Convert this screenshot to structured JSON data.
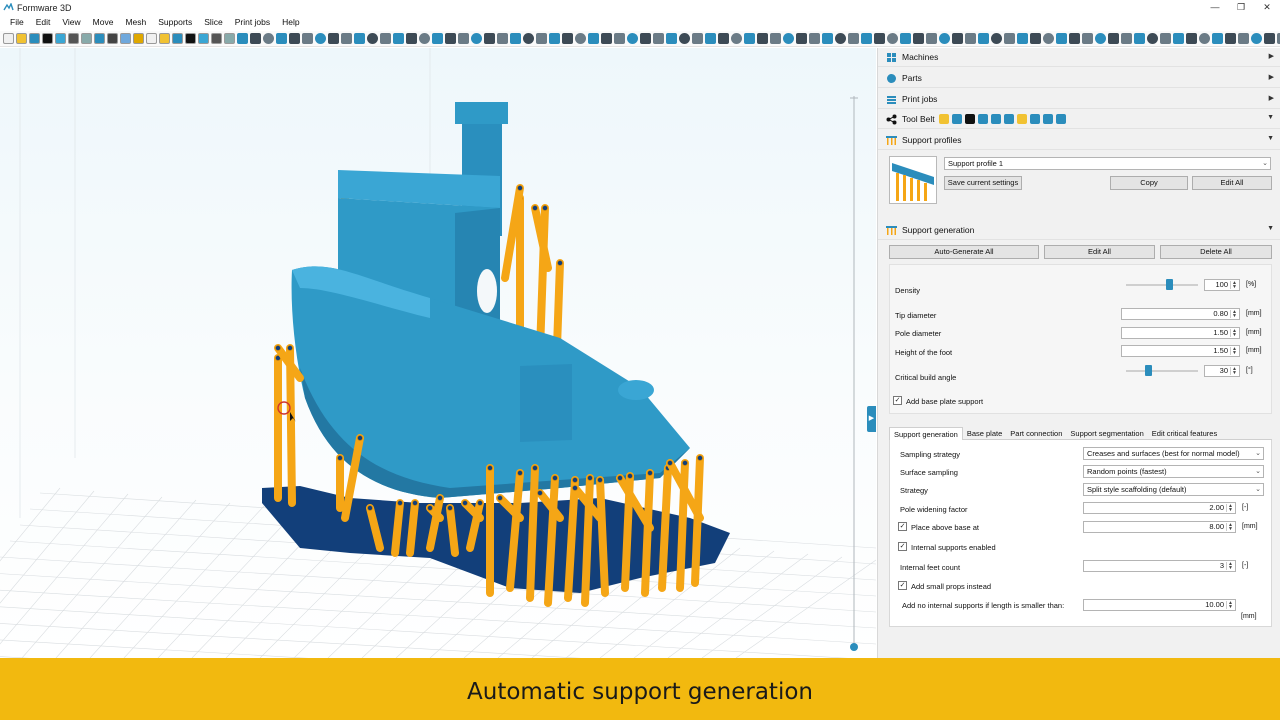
{
  "window": {
    "title": "Formware 3D",
    "controls": [
      "—",
      "❐",
      "✕"
    ]
  },
  "menu": [
    "File",
    "Edit",
    "View",
    "Move",
    "Mesh",
    "Supports",
    "Slice",
    "Print jobs",
    "Help"
  ],
  "panel": {
    "sections": {
      "machines": "Machines",
      "parts": "Parts",
      "print_jobs": "Print jobs",
      "tool_belt": "Tool Belt",
      "support_profiles": "Support profiles",
      "support_generation": "Support generation"
    },
    "profile": {
      "selected": "Support profile 1",
      "save_label": "Save current settings",
      "copy_label": "Copy",
      "edit_all_label": "Edit All"
    },
    "generation": {
      "auto_generate_label": "Auto-Generate All",
      "edit_all_label": "Edit All",
      "delete_all_label": "Delete All",
      "density": {
        "label": "Density",
        "value": "100",
        "unit": "[%]",
        "slider_level": 0.6
      },
      "tip_diameter": {
        "label": "Tip diameter",
        "value": "0.80",
        "unit": "[mm]"
      },
      "pole_diameter": {
        "label": "Pole diameter",
        "value": "1.50",
        "unit": "[mm]"
      },
      "foot_height": {
        "label": "Height of the foot",
        "value": "1.50",
        "unit": "[mm]"
      },
      "critical_angle": {
        "label": "Critical build angle",
        "value": "30",
        "unit": "[°]",
        "slider_level": 0.3
      },
      "base_plate_support": {
        "label": "Add base plate support",
        "checked": true
      }
    },
    "tabs": [
      "Support generation",
      "Base plate",
      "Part connection",
      "Support segmentation",
      "Edit critical features"
    ],
    "tab_settings": {
      "sampling_strategy": {
        "label": "Sampling strategy",
        "value": "Creases and surfaces (best for normal model)"
      },
      "surface_sampling": {
        "label": "Surface sampling",
        "value": "Random points (fastest)"
      },
      "strategy": {
        "label": "Strategy",
        "value": "Split style scaffolding (default)"
      },
      "pole_widening": {
        "label": "Pole widening factor",
        "value": "2.00",
        "unit": "[-]"
      },
      "place_above_base": {
        "label": "Place above base at",
        "value": "8.00",
        "unit": "[mm]",
        "checked": true
      },
      "internal_supports": {
        "label": "Internal supports enabled",
        "checked": true
      },
      "internal_feet": {
        "label": "Internal feet count",
        "value": "3",
        "unit": "[-]"
      },
      "small_props": {
        "label": "Add small props instead",
        "checked": true
      },
      "no_internal_if_smaller": {
        "label": "Add no internal supports if length is smaller than:",
        "value": "10.00",
        "unit": "[mm]"
      }
    }
  },
  "caption": "Automatic support generation",
  "colors": {
    "model": "#2f9ac7",
    "support": "#f5a616",
    "base": "#123f7a",
    "caption_bg": "#f2b90f",
    "accent": "#2b8dbc"
  }
}
